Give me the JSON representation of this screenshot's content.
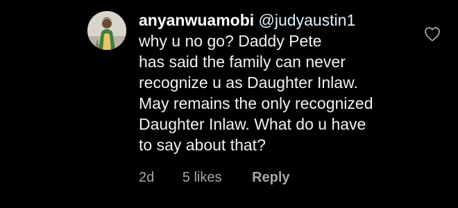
{
  "comment": {
    "username": "anyanwuamobi",
    "mention": "@judyaustin1",
    "lines": [
      "why u no go? Daddy Pete",
      "has said the family can never",
      "recognize u as Daughter Inlaw.",
      "May remains the only recognized",
      "Daughter Inlaw. What do u have",
      "to say about that?"
    ],
    "time": "2d",
    "likes": "5 likes",
    "reply_label": "Reply",
    "like_icon": "heart-outline-icon"
  },
  "colors": {
    "background": "#000000",
    "text": "#f2f2f2",
    "mention": "#e0f1ff",
    "meta": "#a8a8a8"
  }
}
